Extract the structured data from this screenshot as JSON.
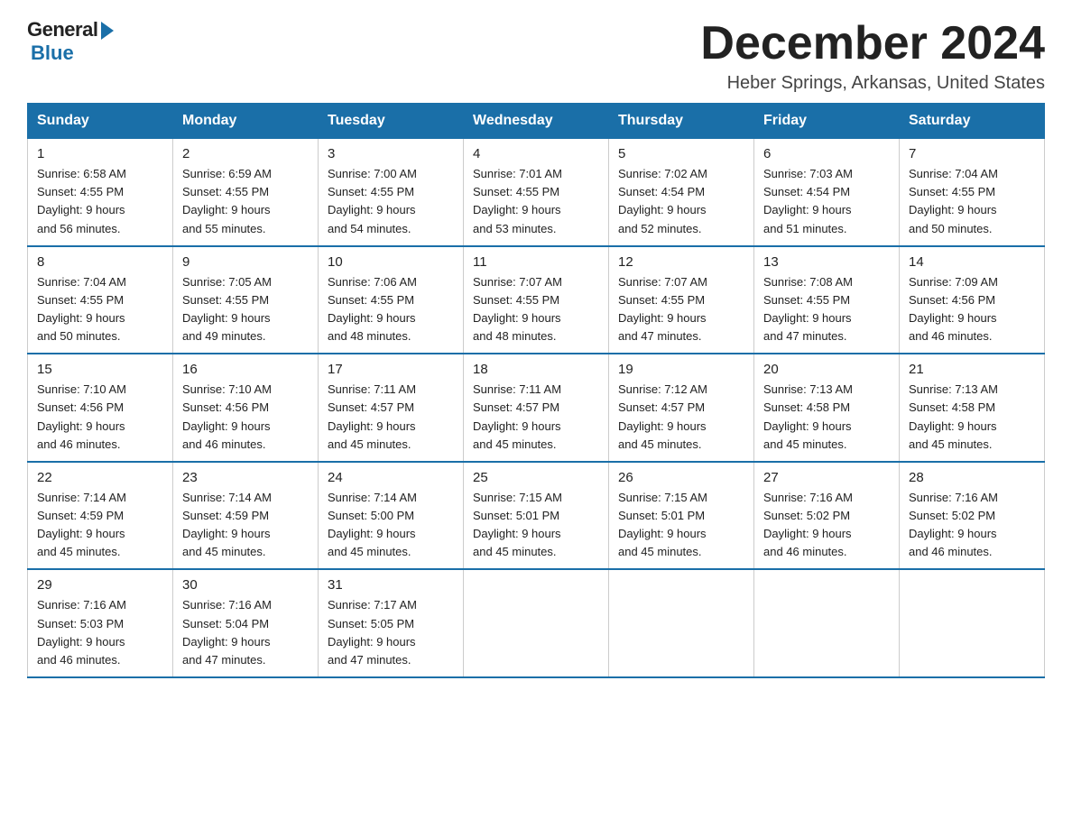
{
  "header": {
    "logo_general": "General",
    "logo_blue": "Blue",
    "month_title": "December 2024",
    "location": "Heber Springs, Arkansas, United States"
  },
  "days_of_week": [
    "Sunday",
    "Monday",
    "Tuesday",
    "Wednesday",
    "Thursday",
    "Friday",
    "Saturday"
  ],
  "weeks": [
    [
      {
        "day": "1",
        "sunrise": "6:58 AM",
        "sunset": "4:55 PM",
        "daylight": "9 hours and 56 minutes."
      },
      {
        "day": "2",
        "sunrise": "6:59 AM",
        "sunset": "4:55 PM",
        "daylight": "9 hours and 55 minutes."
      },
      {
        "day": "3",
        "sunrise": "7:00 AM",
        "sunset": "4:55 PM",
        "daylight": "9 hours and 54 minutes."
      },
      {
        "day": "4",
        "sunrise": "7:01 AM",
        "sunset": "4:55 PM",
        "daylight": "9 hours and 53 minutes."
      },
      {
        "day": "5",
        "sunrise": "7:02 AM",
        "sunset": "4:54 PM",
        "daylight": "9 hours and 52 minutes."
      },
      {
        "day": "6",
        "sunrise": "7:03 AM",
        "sunset": "4:54 PM",
        "daylight": "9 hours and 51 minutes."
      },
      {
        "day": "7",
        "sunrise": "7:04 AM",
        "sunset": "4:55 PM",
        "daylight": "9 hours and 50 minutes."
      }
    ],
    [
      {
        "day": "8",
        "sunrise": "7:04 AM",
        "sunset": "4:55 PM",
        "daylight": "9 hours and 50 minutes."
      },
      {
        "day": "9",
        "sunrise": "7:05 AM",
        "sunset": "4:55 PM",
        "daylight": "9 hours and 49 minutes."
      },
      {
        "day": "10",
        "sunrise": "7:06 AM",
        "sunset": "4:55 PM",
        "daylight": "9 hours and 48 minutes."
      },
      {
        "day": "11",
        "sunrise": "7:07 AM",
        "sunset": "4:55 PM",
        "daylight": "9 hours and 48 minutes."
      },
      {
        "day": "12",
        "sunrise": "7:07 AM",
        "sunset": "4:55 PM",
        "daylight": "9 hours and 47 minutes."
      },
      {
        "day": "13",
        "sunrise": "7:08 AM",
        "sunset": "4:55 PM",
        "daylight": "9 hours and 47 minutes."
      },
      {
        "day": "14",
        "sunrise": "7:09 AM",
        "sunset": "4:56 PM",
        "daylight": "9 hours and 46 minutes."
      }
    ],
    [
      {
        "day": "15",
        "sunrise": "7:10 AM",
        "sunset": "4:56 PM",
        "daylight": "9 hours and 46 minutes."
      },
      {
        "day": "16",
        "sunrise": "7:10 AM",
        "sunset": "4:56 PM",
        "daylight": "9 hours and 46 minutes."
      },
      {
        "day": "17",
        "sunrise": "7:11 AM",
        "sunset": "4:57 PM",
        "daylight": "9 hours and 45 minutes."
      },
      {
        "day": "18",
        "sunrise": "7:11 AM",
        "sunset": "4:57 PM",
        "daylight": "9 hours and 45 minutes."
      },
      {
        "day": "19",
        "sunrise": "7:12 AM",
        "sunset": "4:57 PM",
        "daylight": "9 hours and 45 minutes."
      },
      {
        "day": "20",
        "sunrise": "7:13 AM",
        "sunset": "4:58 PM",
        "daylight": "9 hours and 45 minutes."
      },
      {
        "day": "21",
        "sunrise": "7:13 AM",
        "sunset": "4:58 PM",
        "daylight": "9 hours and 45 minutes."
      }
    ],
    [
      {
        "day": "22",
        "sunrise": "7:14 AM",
        "sunset": "4:59 PM",
        "daylight": "9 hours and 45 minutes."
      },
      {
        "day": "23",
        "sunrise": "7:14 AM",
        "sunset": "4:59 PM",
        "daylight": "9 hours and 45 minutes."
      },
      {
        "day": "24",
        "sunrise": "7:14 AM",
        "sunset": "5:00 PM",
        "daylight": "9 hours and 45 minutes."
      },
      {
        "day": "25",
        "sunrise": "7:15 AM",
        "sunset": "5:01 PM",
        "daylight": "9 hours and 45 minutes."
      },
      {
        "day": "26",
        "sunrise": "7:15 AM",
        "sunset": "5:01 PM",
        "daylight": "9 hours and 45 minutes."
      },
      {
        "day": "27",
        "sunrise": "7:16 AM",
        "sunset": "5:02 PM",
        "daylight": "9 hours and 46 minutes."
      },
      {
        "day": "28",
        "sunrise": "7:16 AM",
        "sunset": "5:02 PM",
        "daylight": "9 hours and 46 minutes."
      }
    ],
    [
      {
        "day": "29",
        "sunrise": "7:16 AM",
        "sunset": "5:03 PM",
        "daylight": "9 hours and 46 minutes."
      },
      {
        "day": "30",
        "sunrise": "7:16 AM",
        "sunset": "5:04 PM",
        "daylight": "9 hours and 47 minutes."
      },
      {
        "day": "31",
        "sunrise": "7:17 AM",
        "sunset": "5:05 PM",
        "daylight": "9 hours and 47 minutes."
      },
      null,
      null,
      null,
      null
    ]
  ],
  "labels": {
    "sunrise_prefix": "Sunrise: ",
    "sunset_prefix": "Sunset: ",
    "daylight_prefix": "Daylight: "
  }
}
